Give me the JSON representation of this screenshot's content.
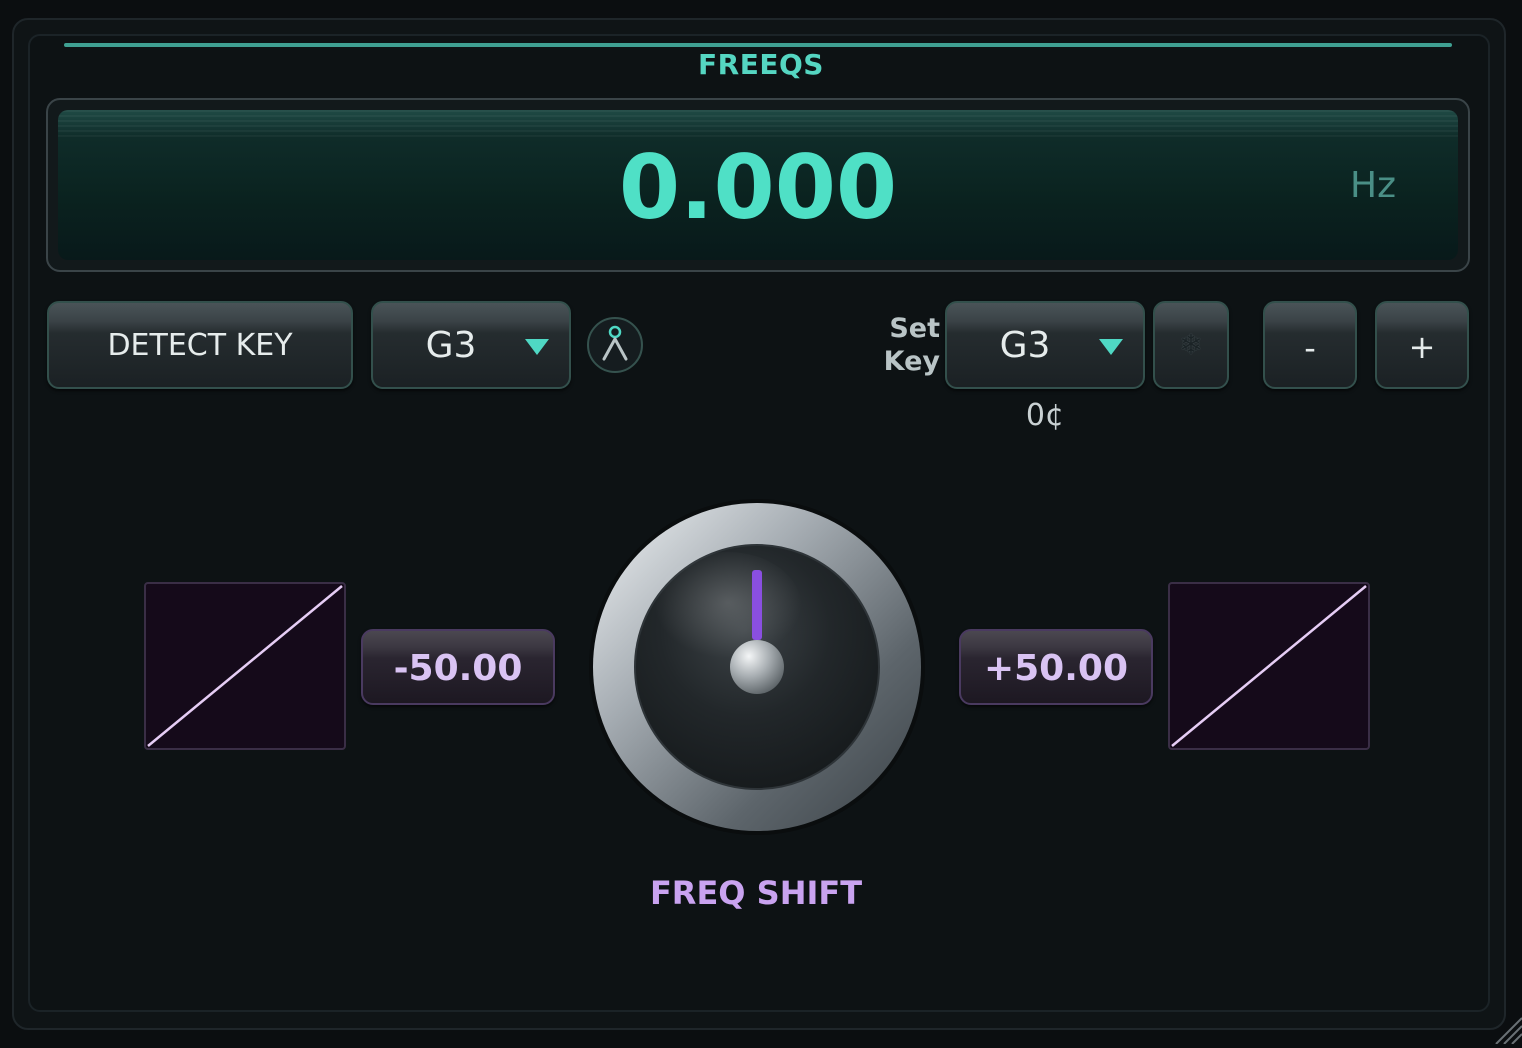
{
  "plugin": {
    "title": "FREEQS"
  },
  "display": {
    "frequency_value": "0.000",
    "unit": "Hz"
  },
  "controls": {
    "detect_key_label": "DETECT KEY",
    "detected_key": "G3",
    "set_key_label_line1": "Set",
    "set_key_label_line2": "Key",
    "set_key_value": "G3",
    "cents": "0¢",
    "minus_label": "-",
    "plus_label": "+",
    "freeze_icon": "snowflake-icon",
    "tuner_icon": "tuning-fork-icon"
  },
  "freq_shift": {
    "label": "FREQ SHIFT",
    "min_value": "-50.00",
    "max_value": "+50.00",
    "knob_position": 0.5
  },
  "colors": {
    "accent_teal": "#4fe0c6",
    "accent_purple": "#c9a3f0",
    "knob_pointer": "#8a4fe0"
  }
}
